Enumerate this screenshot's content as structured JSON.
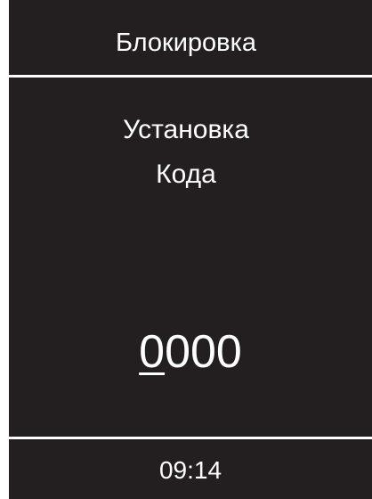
{
  "header": {
    "title": "Блокировка"
  },
  "prompt": {
    "line1": "Установка",
    "line2": "Кода"
  },
  "code": {
    "digits": [
      "0",
      "0",
      "0",
      "0"
    ],
    "active_index": 0
  },
  "footer": {
    "time": "09:14"
  },
  "colors": {
    "background": "#231f20",
    "foreground": "#ffffff"
  }
}
